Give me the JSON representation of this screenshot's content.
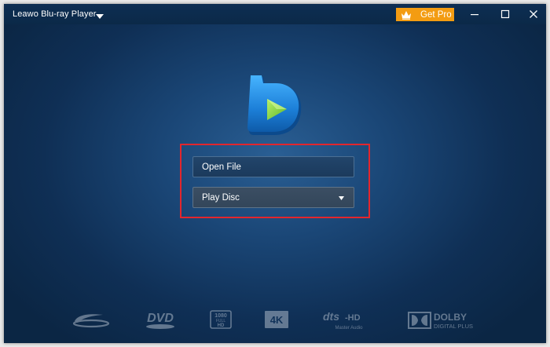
{
  "app": {
    "title": "Leawo Blu-ray Player",
    "get_pro_label": "Get Pro"
  },
  "main": {
    "open_file_label": "Open File",
    "play_disc_label": "Play Disc"
  },
  "format_logos": [
    {
      "name": "blu-ray-logo",
      "text": ""
    },
    {
      "name": "dvd-logo",
      "text": "DVD"
    },
    {
      "name": "full-hd-logo",
      "text": "1080"
    },
    {
      "name": "4k-logo",
      "text": "4K"
    },
    {
      "name": "dts-hd-logo",
      "text": "dts-HD"
    },
    {
      "name": "dolby-logo",
      "text": "DOLBY"
    }
  ],
  "format_logo_text": {
    "fullhd_top": "1080",
    "fullhd_mid": "FULL",
    "fullhd_bot": "HD",
    "k4": "4K",
    "dts": "dts",
    "hd": "-HD",
    "master_audio": "Master Audio",
    "dolby": "DOLBY",
    "digital_plus": "DIGITAL PLUS",
    "dvd": "DVD"
  },
  "colors": {
    "accent_orange": "#f39c12",
    "highlight_red": "#e3262d",
    "logo_blue": "#1e7fd6",
    "logo_play_green": "#7fd13b"
  }
}
